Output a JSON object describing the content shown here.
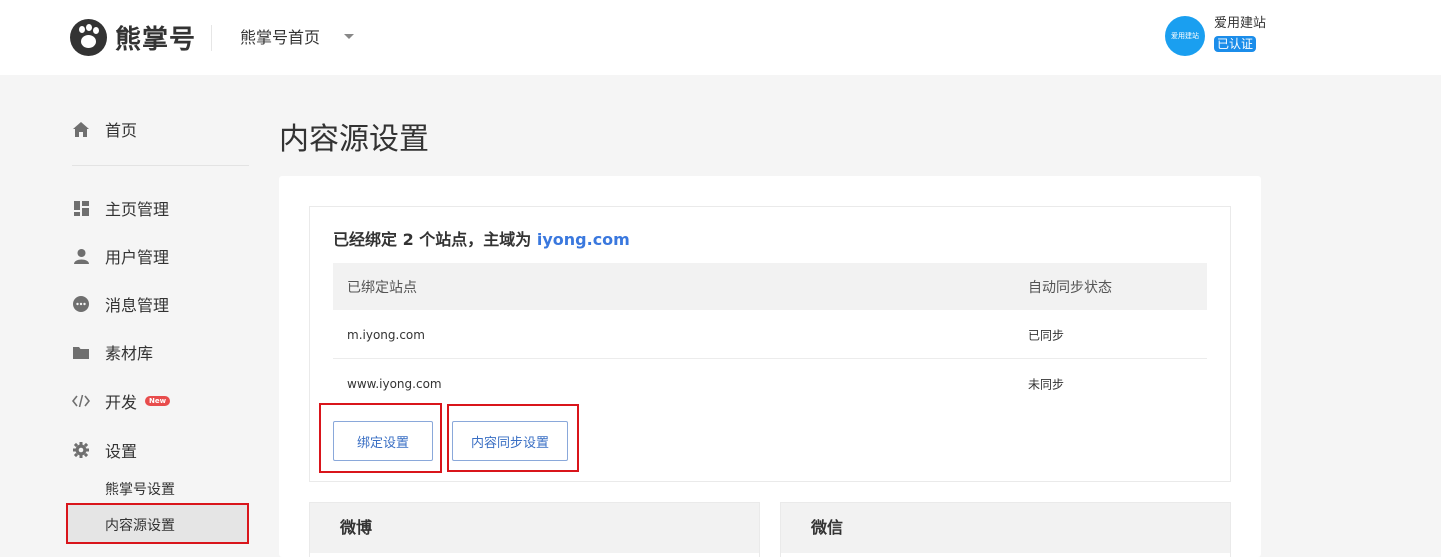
{
  "header": {
    "logo_text": "熊掌号",
    "nav_label": "熊掌号首页",
    "user_name": "爱用建站",
    "verified_label": "已认证",
    "avatar_text": "爱用建站"
  },
  "sidebar": {
    "items": [
      {
        "label": "首页",
        "icon": "home-icon"
      },
      {
        "label": "主页管理",
        "icon": "dashboard-icon"
      },
      {
        "label": "用户管理",
        "icon": "user-icon"
      },
      {
        "label": "消息管理",
        "icon": "chat-icon"
      },
      {
        "label": "素材库",
        "icon": "folder-icon"
      },
      {
        "label": "开发",
        "icon": "code-icon",
        "badge": "New"
      },
      {
        "label": "设置",
        "icon": "gear-icon"
      }
    ],
    "sub_items": [
      {
        "label": "熊掌号设置"
      },
      {
        "label": "内容源设置",
        "active": true
      }
    ]
  },
  "main": {
    "page_title": "内容源设置",
    "bind_summary_prefix": "已经绑定 2 个站点，主域为 ",
    "bind_summary_domain": "iyong.com",
    "table": {
      "headers": [
        "已绑定站点",
        "自动同步状态"
      ],
      "rows": [
        [
          "m.iyong.com",
          "已同步"
        ],
        [
          "www.iyong.com",
          "未同步"
        ]
      ]
    },
    "buttons": {
      "bind_settings": "绑定设置",
      "sync_settings": "内容同步设置"
    },
    "cards": [
      {
        "title": "微博"
      },
      {
        "title": "微信"
      }
    ]
  },
  "colors": {
    "accent": "#3a78de",
    "highlight_box": "#d9151b",
    "avatar": "#1a9ff0",
    "badge": "#e84c4c"
  }
}
